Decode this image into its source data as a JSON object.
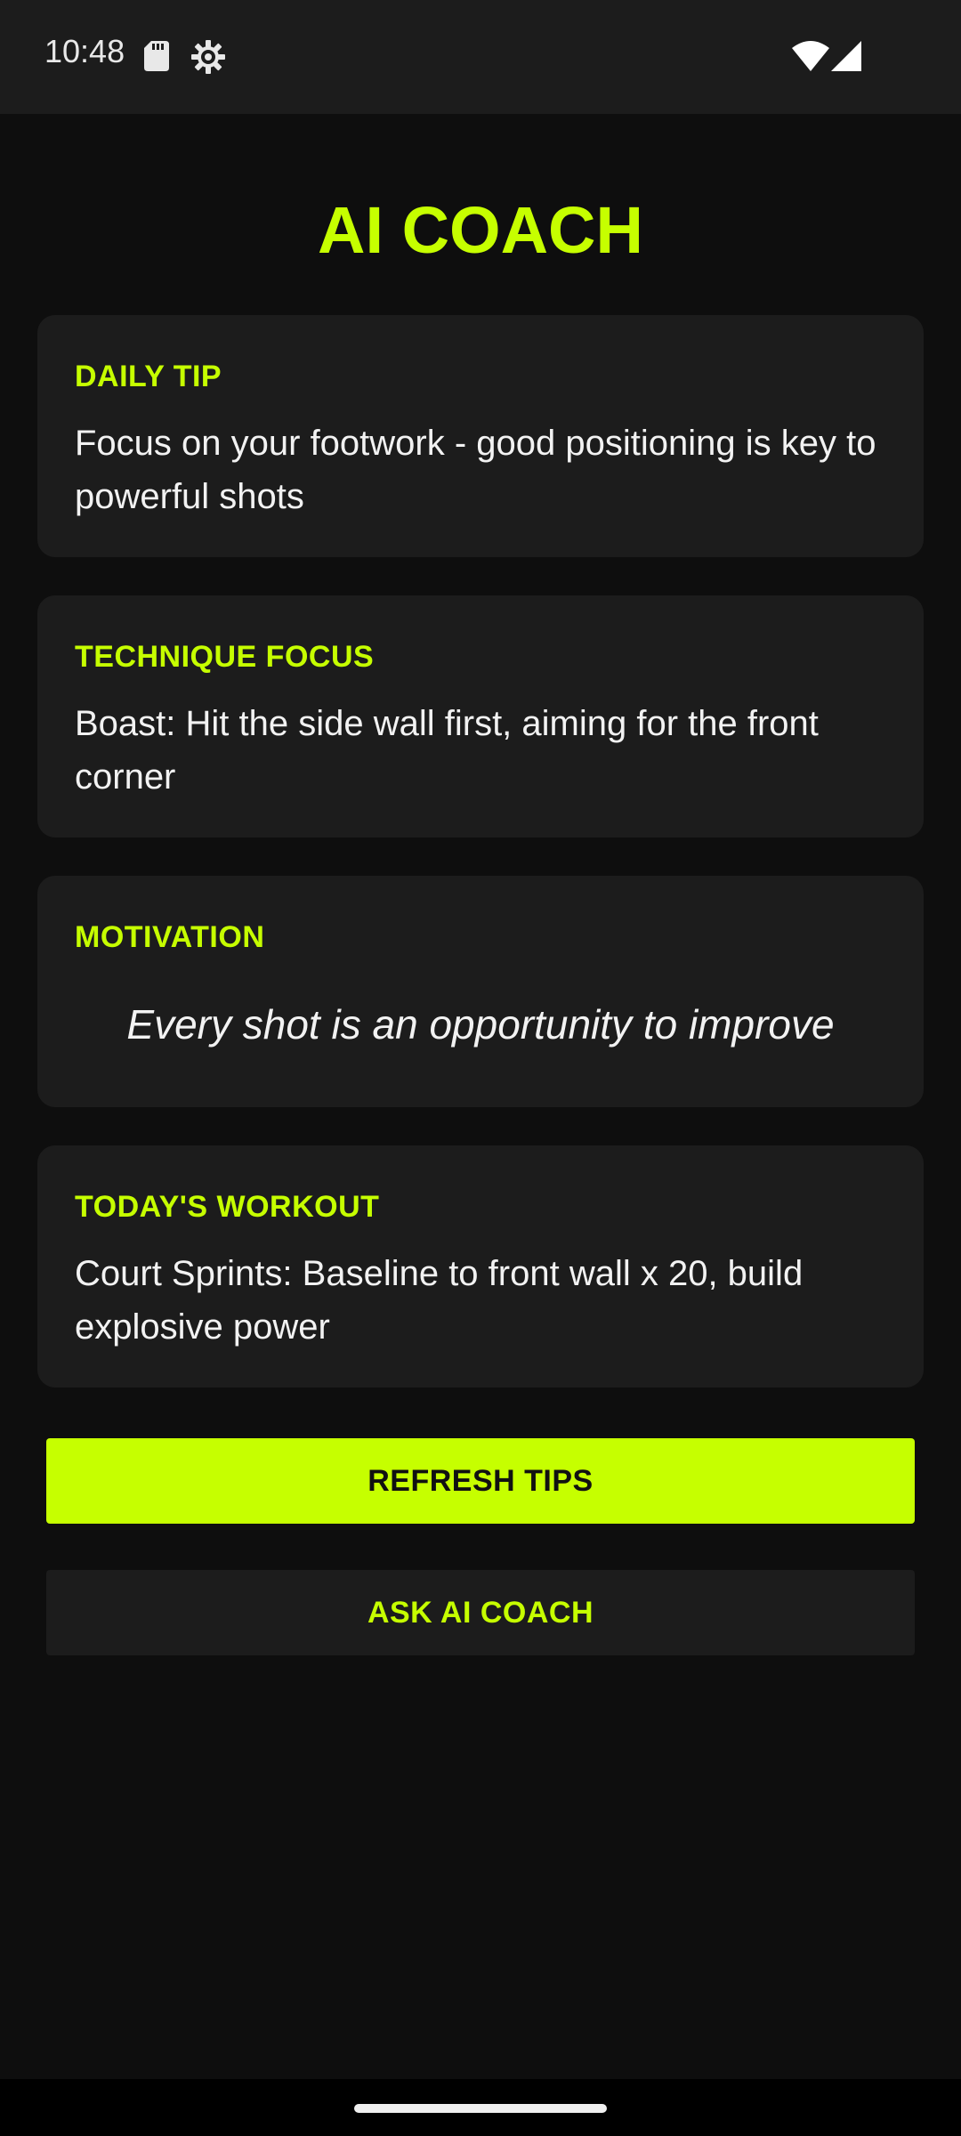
{
  "status_bar": {
    "time": "10:48",
    "icons": [
      "sd-card-icon",
      "settings-gear-icon",
      "wifi-icon",
      "cell-signal-icon"
    ]
  },
  "header": {
    "title": "AI COACH"
  },
  "cards": {
    "daily_tip": {
      "label": "DAILY TIP",
      "text": "Focus on your footwork - good positioning is key to powerful shots"
    },
    "technique": {
      "label": "TECHNIQUE FOCUS",
      "text": "Boast: Hit the side wall first, aiming for the front corner"
    },
    "motivation": {
      "label": "MOTIVATION",
      "text": "Every shot is an opportunity to improve"
    },
    "workout": {
      "label": "TODAY'S WORKOUT",
      "text": "Court Sprints: Baseline to front wall x 20, build explosive power"
    }
  },
  "actions": {
    "refresh_label": "REFRESH TIPS",
    "ask_label": "ASK AI COACH"
  },
  "colors": {
    "accent": "#c6ff00",
    "background": "#0e0e0e",
    "card": "#1c1c1c",
    "text": "#f2f2f2"
  }
}
